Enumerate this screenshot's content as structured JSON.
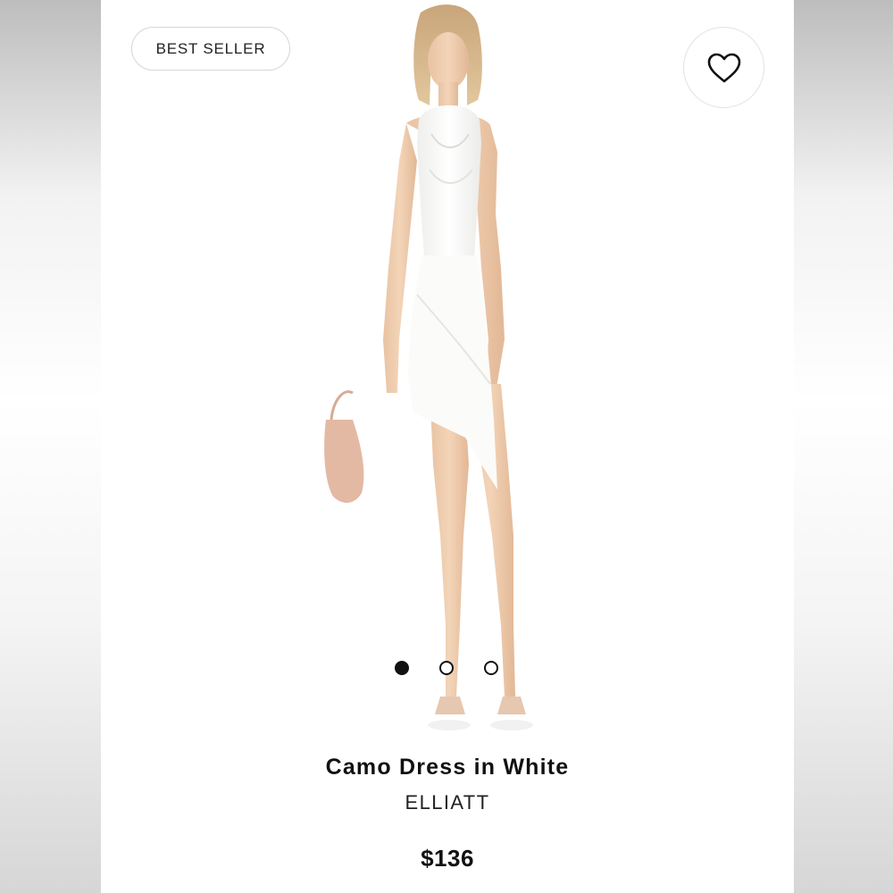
{
  "badge": {
    "label": "BEST SELLER"
  },
  "favorite": {
    "icon": "heart-outline-icon"
  },
  "product": {
    "title": "Camo Dress in White",
    "brand": "ELLIATT",
    "price": "$136",
    "image": "model-in-white-dress-photo"
  },
  "carousel": {
    "total": 3,
    "active_index": 0
  },
  "colors": {
    "text": "#111111",
    "border": "#d6d6d6"
  }
}
